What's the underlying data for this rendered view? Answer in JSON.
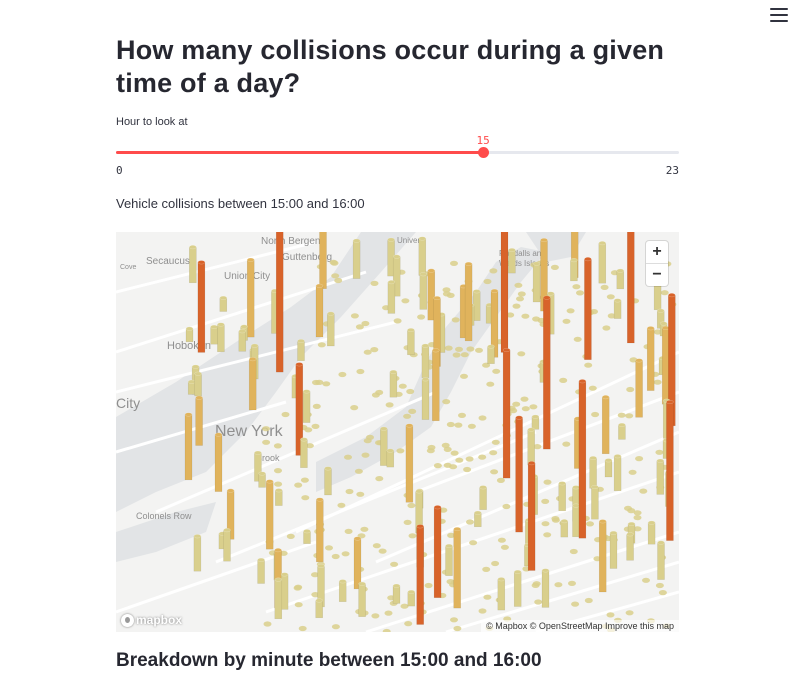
{
  "page": {
    "title": "How many collisions occur during a given time of a day?",
    "section_heading": "Breakdown by minute between 15:00 and 16:00"
  },
  "slider": {
    "label": "Hour to look at",
    "min": 0,
    "max": 23,
    "value": 15,
    "min_label": "0",
    "max_label": "23",
    "value_label": "15",
    "color": "#ff4b4b"
  },
  "subtitle": "Vehicle collisions between 15:00 and 16:00",
  "map": {
    "zoom_in": "+",
    "zoom_out": "−",
    "attribution": "© Mapbox © OpenStreetMap Improve this map",
    "logo_text": "mapbox",
    "places": {
      "north_bergen": "North Bergen",
      "guttenberg": "Guttenberg",
      "secaucus": "Secaucus",
      "union_city": "Union City",
      "hoboken": "Hoboken",
      "city": "City",
      "new_york": "New York",
      "cove": "Cove",
      "randalls": "Randalls and",
      "wards": "Wards Islands",
      "colonels_row": "Colonels Row",
      "brooklyn": "Brook",
      "university": "Univer"
    },
    "colors": {
      "water": "#e2e4e6",
      "land": "#f3f3f2",
      "tall": "#d8632a",
      "mid": "#e0b35c",
      "short": "#d9cf8c"
    }
  },
  "menu_icon": "hamburger-icon"
}
